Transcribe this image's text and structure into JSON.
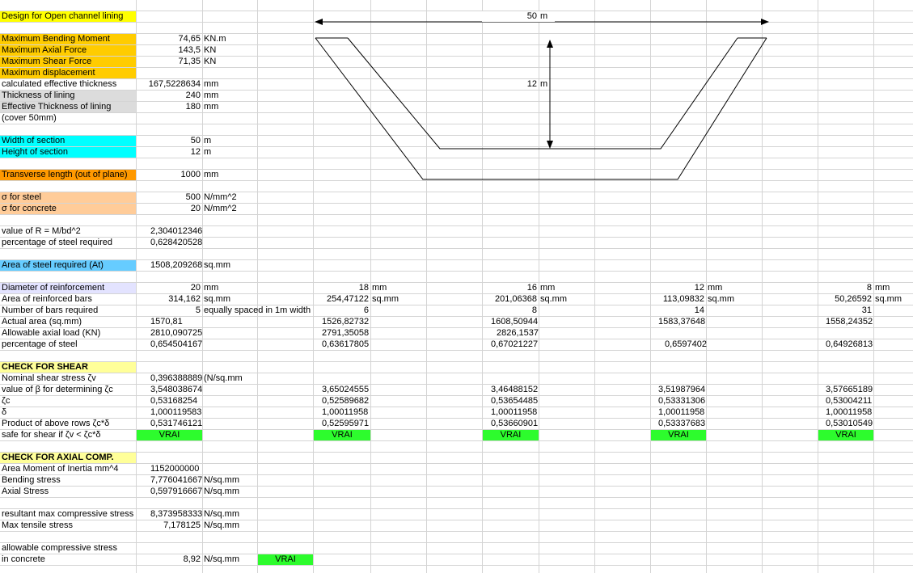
{
  "title": "Design for Open channel lining",
  "loads": {
    "max_bending_label": "Maximum Bending Moment",
    "max_bending_value": "74,65",
    "max_bending_unit": "KN.m",
    "max_axial_label": "Maximum Axial Force",
    "max_axial_value": "143,5",
    "max_axial_unit": "KN",
    "max_shear_label": "Maximum Shear Force",
    "max_shear_value": "71,35",
    "max_shear_unit": "KN",
    "max_disp_label": "Maximum displacement"
  },
  "thickness": {
    "calc_label": "calculated effective thickness",
    "calc_value": "167,5228634",
    "calc_unit": "mm",
    "lining_label": "Thickness of lining",
    "lining_value": "240",
    "lining_unit": "mm",
    "eff_label": "Effective Thickness of lining",
    "eff_value": "180",
    "eff_unit": "mm",
    "cover_label": "(cover 50mm)"
  },
  "section": {
    "width_label": "Width of section",
    "width_value": "50",
    "width_unit": "m",
    "height_label": "Height of section",
    "height_value": "12",
    "height_unit": "m"
  },
  "transverse": {
    "label": "Transverse length (out of plane)",
    "value": "1000",
    "unit": "mm"
  },
  "sigma": {
    "steel_label": "σ for steel",
    "steel_value": "500",
    "steel_unit": "N/mm^2",
    "concrete_label": "σ for concrete",
    "concrete_value": "20",
    "concrete_unit": "N/mm^2"
  },
  "r_value": {
    "r_label": "value of R = M/bd^2",
    "r_value": "2,304012346",
    "pct_label": "percentage of steel required",
    "pct_value": "0,628420528"
  },
  "area_steel": {
    "label": "Area of steel required (At)",
    "value": "1508,209268",
    "unit": "sq.mm"
  },
  "reinforcement": {
    "labels": {
      "diameter": "Diameter of reinforcement",
      "area": "Area of reinforced bars",
      "number": "Number of bars required",
      "actual": "Actual area (sq.mm)",
      "allowable": "Allowable axial load (KN)",
      "pct": "percentage of steel"
    },
    "note": "equally spaced in 1m width",
    "cols": [
      {
        "diameter": "20",
        "dia_unit": "mm",
        "area": "314,162",
        "area_unit": "sq.mm",
        "number": "5",
        "actual": "1570,81",
        "allowable": "2810,090725",
        "pct": "0,654504167"
      },
      {
        "diameter": "18",
        "dia_unit": "mm",
        "area": "254,47122",
        "area_unit": "sq.mm",
        "number": "6",
        "actual": "1526,82732",
        "allowable": "2791,35058",
        "pct": "0,63617805"
      },
      {
        "diameter": "16",
        "dia_unit": "mm",
        "area": "201,06368",
        "area_unit": "sq.mm",
        "number": "8",
        "actual": "1608,50944",
        "allowable": "2826,1537",
        "pct": "0,67021227"
      },
      {
        "diameter": "12",
        "dia_unit": "mm",
        "area": "113,09832",
        "area_unit": "sq.mm",
        "number": "14",
        "actual": "1583,37648",
        "allowable": "",
        "pct": "0,6597402"
      },
      {
        "diameter": "8",
        "dia_unit": "mm",
        "area": "50,26592",
        "area_unit": "sq.mm",
        "number": "31",
        "actual": "1558,24352",
        "allowable": "",
        "pct": "0,64926813"
      }
    ]
  },
  "shear": {
    "heading": "CHECK FOR SHEAR",
    "labels": {
      "nominal": "Nominal shear stress  ζv",
      "beta": "value of β for determining  ζc",
      "zc": "ζc",
      "delta": "δ",
      "product": "Product of above rows  ζc*δ",
      "safe": "safe for shear  if  ζv <  ζc*δ"
    },
    "nominal_value": "0,396388889",
    "nominal_unit": "(N/sq.mm",
    "cols": [
      {
        "beta": "3,548038674",
        "zc": "0,53168254",
        "delta": "1,000119583",
        "product": "0,531746121",
        "safe": "VRAI"
      },
      {
        "beta": "3,65024555",
        "zc": "0,52589682",
        "delta": "1,00011958",
        "product": "0,52595971",
        "safe": "VRAI"
      },
      {
        "beta": "3,46488152",
        "zc": "0,53654485",
        "delta": "1,00011958",
        "product": "0,53660901",
        "safe": "VRAI"
      },
      {
        "beta": "3,51987964",
        "zc": "0,53331306",
        "delta": "1,00011958",
        "product": "0,53337683",
        "safe": "VRAI"
      },
      {
        "beta": "3,57665189",
        "zc": "0,53004211",
        "delta": "1,00011958",
        "product": "0,53010549",
        "safe": "VRAI"
      }
    ]
  },
  "axial": {
    "heading": "CHECK FOR AXIAL COMP.",
    "inertia_label": "Area Moment of Inertia mm^4",
    "inertia_value": "1152000000",
    "bending_label": "Bending stress",
    "bending_value": "7,776041667",
    "bending_unit": "N/sq.mm",
    "axial_label": "Axial Stress",
    "axial_value": "0,597916667",
    "axial_unit": "N/sq.mm",
    "resultant_label": "resultant max compressive stress",
    "resultant_value": "8,373958333",
    "resultant_unit": "N/sq.mm",
    "tensile_label": "Max tensile stress",
    "tensile_value": "7,178125",
    "tensile_unit": "N/sq.mm",
    "allow_label1": "allowable compressive stress",
    "allow_label2": "in concrete",
    "allow_value": "8,92",
    "allow_unit": "N/sq.mm",
    "allow_check": "VRAI"
  },
  "diagram": {
    "width_label": "50",
    "width_unit": "m",
    "height_label": "12",
    "height_unit": "m"
  }
}
